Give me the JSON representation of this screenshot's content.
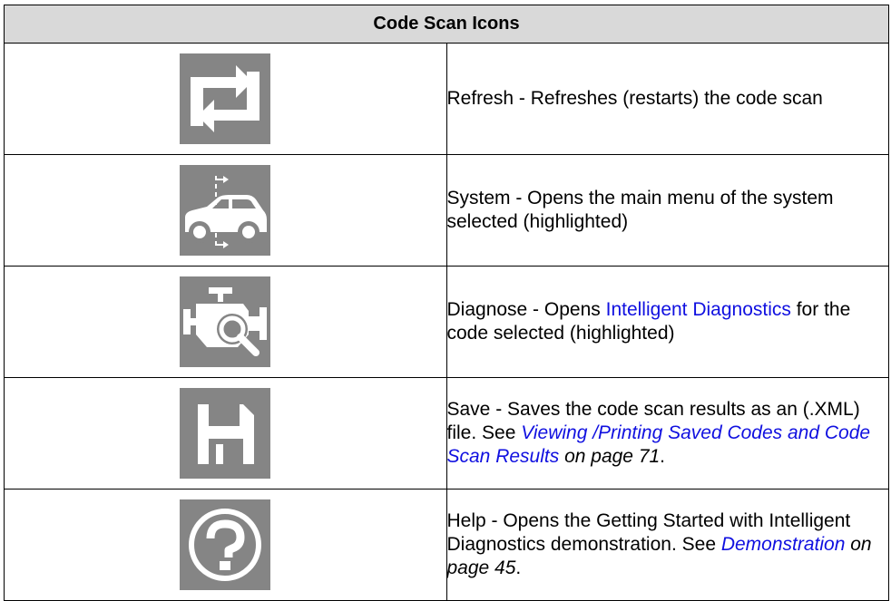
{
  "table": {
    "title": "Code Scan Icons",
    "rows": [
      {
        "icon": "refresh-icon",
        "text": "Refresh - Refreshes (restarts) the code scan"
      },
      {
        "icon": "car-system-icon",
        "text": "System - Opens the main menu of the system selected (highlighted)"
      },
      {
        "icon": "engine-search-icon",
        "text_before": "Diagnose - Opens ",
        "link": "Intelligent Diagnostics",
        "text_after": " for the code selected (highlighted)"
      },
      {
        "icon": "save-icon",
        "text_before": "Save - Saves the code scan results as an (.XML) file. See ",
        "xref": "Viewing /Printing Saved Codes and Code Scan Results",
        "page_ref": " on page 71",
        "end": "."
      },
      {
        "icon": "help-icon",
        "text_before": "Help - Opens the Getting Started with Intelligent Diagnostics demonstration. See ",
        "xref": "Demonstration",
        "page_ref": " on page 45",
        "end": "."
      }
    ]
  },
  "colors": {
    "header_bg": "#d9d9d9",
    "icon_bg": "#858585",
    "link": "#1010e0"
  }
}
